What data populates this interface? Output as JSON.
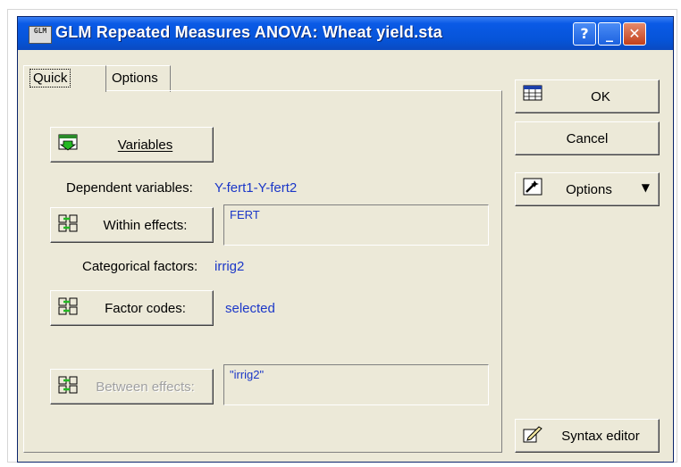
{
  "window": {
    "title": "GLM Repeated Measures ANOVA: Wheat yield.sta",
    "app_icon_text": "GLM",
    "help_label": "?",
    "minimize_label": "_",
    "close_label": "✕"
  },
  "tabs": [
    {
      "label": "Quick",
      "active": true
    },
    {
      "label": "Options",
      "active": false
    }
  ],
  "quick": {
    "variables_button": "Variables",
    "dependent_label": "Dependent variables:",
    "dependent_value": "Y-fert1-Y-fert2",
    "within_button": "Within effects:",
    "within_value": "FERT",
    "categorical_label": "Categorical factors:",
    "categorical_value": "irrig2",
    "factor_codes_button": "Factor codes:",
    "factor_codes_value": "selected",
    "between_button": "Between effects:",
    "between_value": "\"irrig2\""
  },
  "side": {
    "ok_button": "OK",
    "cancel_button": "Cancel",
    "options_button": "Options",
    "options_arrow": "▼",
    "syntax_button": "Syntax editor"
  },
  "colors": {
    "title_bar": "#0654d8",
    "value_text": "#1b37c8",
    "dialog_bg": "#ece9d8",
    "close_button": "#c2401c"
  }
}
